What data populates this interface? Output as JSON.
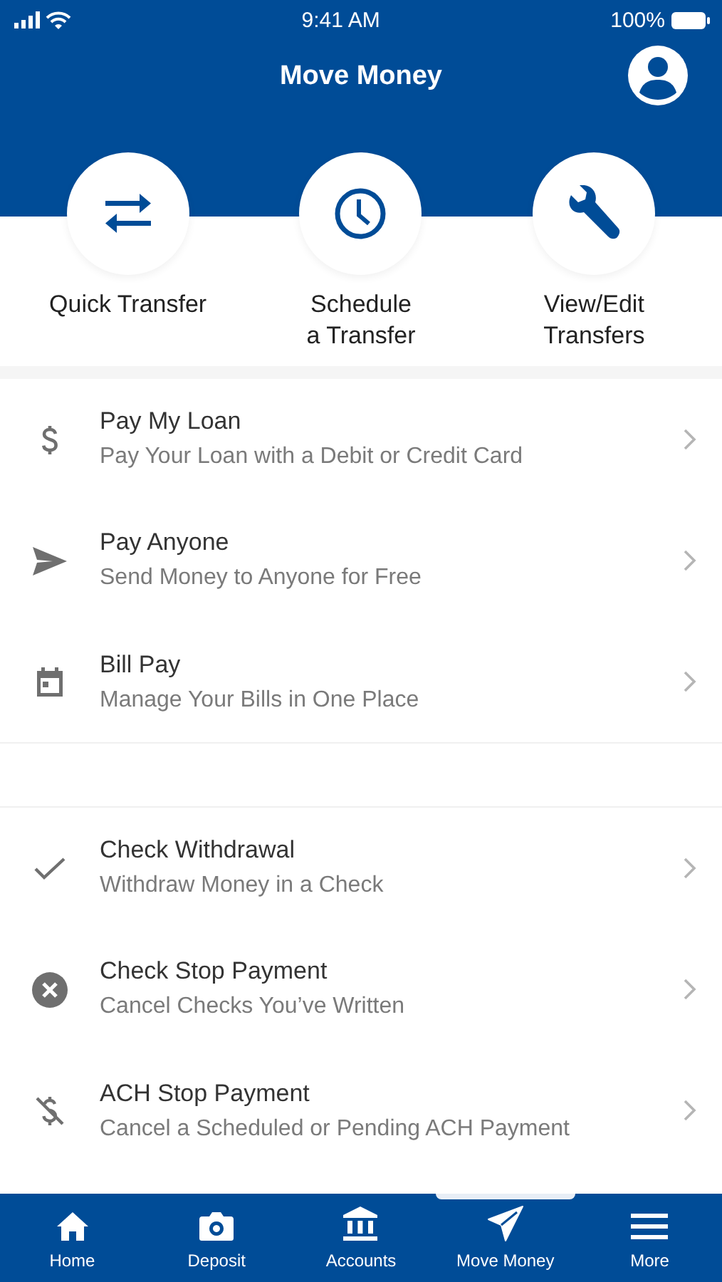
{
  "status_bar": {
    "time": "9:41 AM",
    "battery": "100%"
  },
  "header": {
    "title": "Move Money"
  },
  "quick_actions": [
    {
      "label": "Quick Transfer",
      "kind": "transfer"
    },
    {
      "label": "Schedule\na Transfer",
      "kind": "schedule"
    },
    {
      "label": "View/Edit\nTransfers",
      "kind": "edit"
    }
  ],
  "sections": [
    {
      "items": [
        {
          "title": "Pay My Loan",
          "subtitle": "Pay Your Loan with a Debit or Credit Card",
          "kind": "dollar"
        },
        {
          "title": "Pay Anyone",
          "subtitle": "Send Money to Anyone for Free",
          "kind": "send"
        },
        {
          "title": "Bill Pay",
          "subtitle": "Manage Your Bills in One Place",
          "kind": "calendar"
        }
      ]
    },
    {
      "items": [
        {
          "title": "Check Withdrawal",
          "subtitle": "Withdraw Money in a Check",
          "kind": "check"
        },
        {
          "title": "Check Stop Payment",
          "subtitle": "Cancel Checks You’ve Written",
          "kind": "cancel"
        },
        {
          "title": "ACH Stop Payment",
          "subtitle": "Cancel a Scheduled or Pending ACH Payment",
          "kind": "no-dollar"
        }
      ]
    }
  ],
  "tab_bar": [
    {
      "label": "Home",
      "kind": "home",
      "selected": false
    },
    {
      "label": "Deposit",
      "kind": "camera",
      "selected": false
    },
    {
      "label": "Accounts",
      "kind": "bank",
      "selected": false
    },
    {
      "label": "Move Money",
      "kind": "send",
      "selected": true
    },
    {
      "label": "More",
      "kind": "menu",
      "selected": false
    }
  ]
}
